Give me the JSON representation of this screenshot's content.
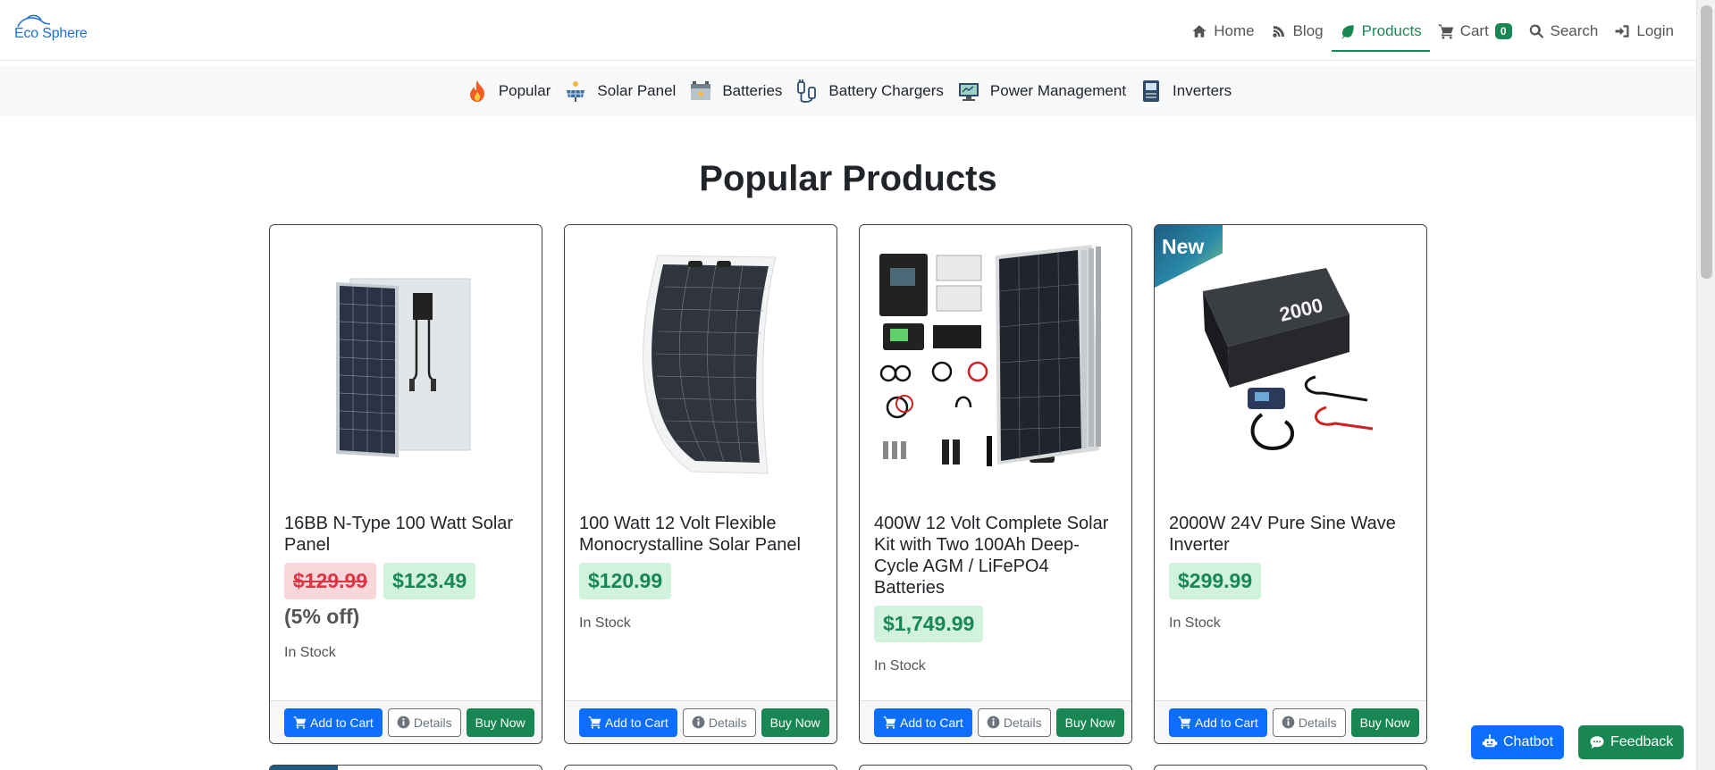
{
  "brand": {
    "name": "Eco Sphere",
    "logo_icon": "car-leaf-logo"
  },
  "nav": {
    "items": [
      {
        "label": "Home",
        "icon": "home-icon"
      },
      {
        "label": "Blog",
        "icon": "blog-icon"
      },
      {
        "label": "Products",
        "icon": "leaf-icon",
        "active": true
      },
      {
        "label": "Cart",
        "icon": "cart-icon",
        "badge": "0"
      },
      {
        "label": "Search",
        "icon": "search-icon"
      },
      {
        "label": "Login",
        "icon": "login-icon"
      }
    ]
  },
  "categories": [
    {
      "label": "Popular",
      "icon": "fire-icon"
    },
    {
      "label": "Solar Panel",
      "icon": "solar-panel-icon"
    },
    {
      "label": "Batteries",
      "icon": "battery-icon"
    },
    {
      "label": "Battery Chargers",
      "icon": "charger-icon"
    },
    {
      "label": "Power Management",
      "icon": "power-management-icon"
    },
    {
      "label": "Inverters",
      "icon": "inverter-icon"
    }
  ],
  "page_title": "Popular Products",
  "products": [
    {
      "title": "16BB N-Type 100 Watt Solar Panel",
      "old_price": "$129.99",
      "price": "$123.49",
      "discount": "(5% off)",
      "stock": "In Stock",
      "image": "rigid-solar-panel-image"
    },
    {
      "title": "100 Watt 12 Volt Flexible Monocrystalline Solar Panel",
      "price": "$120.99",
      "stock": "In Stock",
      "image": "flexible-solar-panel-image"
    },
    {
      "title": "400W 12 Volt Complete Solar Kit with Two 100Ah Deep-Cycle AGM / LiFePO4 Batteries",
      "price": "$1,749.99",
      "stock": "In Stock",
      "image": "solar-kit-image"
    },
    {
      "title": "2000W 24V Pure Sine Wave Inverter",
      "price": "$299.99",
      "stock": "In Stock",
      "badge": "New",
      "image": "inverter-image",
      "image_text": "2000"
    }
  ],
  "buttons": {
    "add_to_cart": "Add to Cart",
    "details": "Details",
    "buy_now": "Buy Now"
  },
  "floating": {
    "chatbot": "Chatbot",
    "feedback": "Feedback"
  },
  "colors": {
    "primary": "#0d6efd",
    "success": "#198754",
    "danger": "#dc3545",
    "brand": "#1e6fd9"
  }
}
